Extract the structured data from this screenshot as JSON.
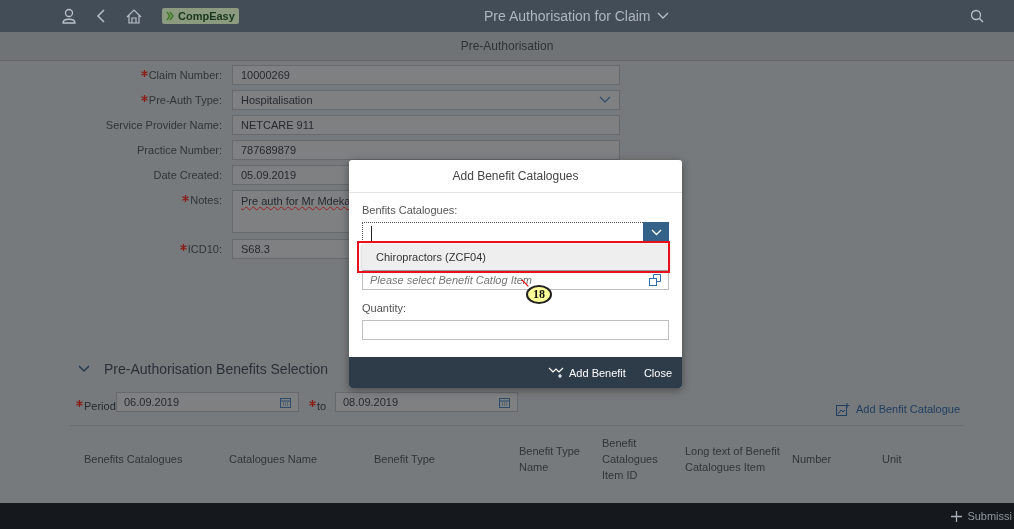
{
  "shell": {
    "logo": "CompEasy",
    "title": "Pre Authorisation for Claim"
  },
  "page": {
    "title": "Pre-Authorisation"
  },
  "form": {
    "fields": [
      {
        "label": "Claim Number:",
        "required": true,
        "value": "10000269",
        "kind": "text"
      },
      {
        "label": "Pre-Auth Type:",
        "required": true,
        "value": "Hospitalisation",
        "kind": "select"
      },
      {
        "label": "Service Provider Name:",
        "required": false,
        "value": "NETCARE 911",
        "kind": "text"
      },
      {
        "label": "Practice Number:",
        "required": false,
        "value": "787689879",
        "kind": "text"
      },
      {
        "label": "Date Created:",
        "required": false,
        "value": "05.09.2019",
        "kind": "text"
      },
      {
        "label": "Notes:",
        "required": true,
        "value": "Pre auth for Mr Mdeka",
        "kind": "textarea"
      },
      {
        "label": "ICD10:",
        "required": true,
        "value": "S68.3",
        "kind": "text"
      }
    ]
  },
  "benefits": {
    "title": "Pre-Authorisation Benefits Selection",
    "expanded": true,
    "period_label": "Period",
    "period_required": true,
    "to_required": true,
    "period_from": "06.09.2019",
    "to_label": "to",
    "period_to": "08.09.2019",
    "add_link": "Add Benfit Catalogue",
    "columns": [
      "Benefits Catalogues",
      "Catalogues Name",
      "Benefit Type",
      "Benefit Type Name",
      "Benefit Catalogues Item ID",
      "Long text of Benefit Catalogues Item",
      "Number",
      "Unit"
    ]
  },
  "footer": {
    "button": "Submissi"
  },
  "dialog": {
    "title": "Add Benefit Catalogues",
    "catalogue_label": "Benfits Catalogues:",
    "options": [
      {
        "label": "Chiropractors (ZCF04)"
      }
    ],
    "item_placeholder": "Please select Benefit Catlog Item",
    "quantity_label": "Quantity:",
    "buttons": [
      {
        "label": "Add Benefit",
        "kind": "add"
      },
      {
        "label": "Close",
        "kind": "plain"
      }
    ]
  },
  "callout": {
    "number": "18"
  }
}
